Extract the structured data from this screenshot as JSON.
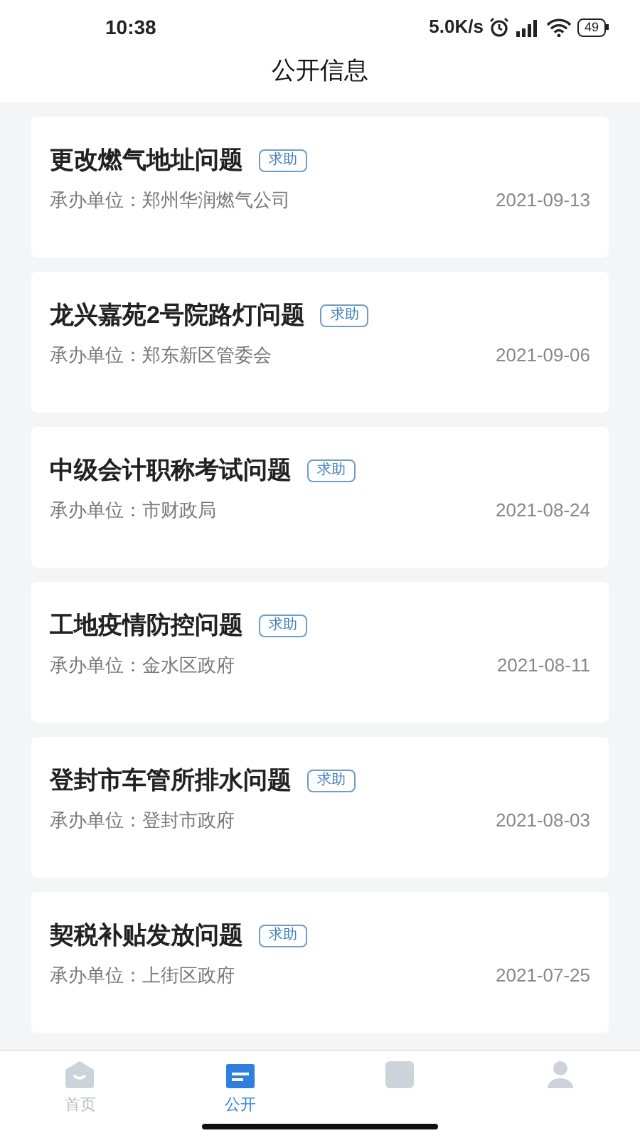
{
  "status_bar": {
    "time": "10:38",
    "speed": "5.0K/s",
    "battery": "49"
  },
  "header": {
    "title": "公开信息"
  },
  "items": [
    {
      "title": "更改燃气地址问题",
      "tag": "求助",
      "unit_label": "承办单位：",
      "unit": "郑州华润燃气公司",
      "date": "2021-09-13"
    },
    {
      "title": "龙兴嘉苑2号院路灯问题",
      "tag": "求助",
      "unit_label": "承办单位：",
      "unit": "郑东新区管委会",
      "date": "2021-09-06"
    },
    {
      "title": "中级会计职称考试问题",
      "tag": "求助",
      "unit_label": "承办单位：",
      "unit": "市财政局",
      "date": "2021-08-24"
    },
    {
      "title": "工地疫情防控问题",
      "tag": "求助",
      "unit_label": "承办单位：",
      "unit": "金水区政府",
      "date": "2021-08-11"
    },
    {
      "title": "登封市车管所排水问题",
      "tag": "求助",
      "unit_label": "承办单位：",
      "unit": "登封市政府",
      "date": "2021-08-03"
    },
    {
      "title": "契税补贴发放问题",
      "tag": "求助",
      "unit_label": "承办单位：",
      "unit": "上街区政府",
      "date": "2021-07-25"
    }
  ],
  "tabs": [
    {
      "kind": "home",
      "label": "首页",
      "selected": false
    },
    {
      "kind": "public",
      "label": "公开",
      "selected": true
    },
    {
      "kind": "square",
      "selected": false
    },
    {
      "kind": "person",
      "selected": false
    }
  ]
}
